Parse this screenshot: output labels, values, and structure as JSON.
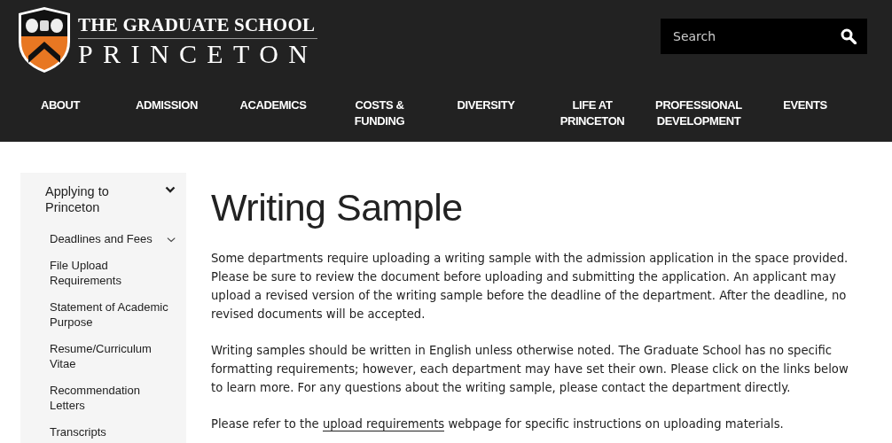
{
  "header": {
    "logo": {
      "line_1": "THE GRADUATE SCHOOL",
      "line_2": "PRINCETON"
    },
    "search": {
      "placeholder": "Search"
    }
  },
  "nav": [
    {
      "label": "ABOUT"
    },
    {
      "label": "ADMISSION"
    },
    {
      "label": "ACADEMICS"
    },
    {
      "label": "COSTS & FUNDING"
    },
    {
      "label": "DIVERSITY"
    },
    {
      "label": "LIFE AT PRINCETON"
    },
    {
      "label": "PROFESSIONAL DEVELOPMENT"
    },
    {
      "label": "EVENTS"
    }
  ],
  "sidebar": {
    "items": [
      {
        "label": "Applying to Princeton",
        "expanded": true,
        "children": [
          {
            "label": "Deadlines and Fees",
            "has_submenu": true
          },
          {
            "label": "File Upload Requirements",
            "has_submenu": false
          },
          {
            "label": "Statement of Academic Purpose",
            "has_submenu": false
          },
          {
            "label": "Resume/Curriculum Vitae",
            "has_submenu": false
          },
          {
            "label": "Recommendation Letters",
            "has_submenu": false
          },
          {
            "label": "Transcripts",
            "has_submenu": false
          }
        ]
      }
    ]
  },
  "main": {
    "title": "Writing Sample",
    "paragraphs": [
      {
        "text": "Some departments require uploading a writing sample with the admission application in the space provided. Please be sure to review the document before uploading and submitting the application. An applicant may upload a revised version of the writing sample before the deadline of the department. After the deadline, no revised documents will be accepted."
      },
      {
        "text": "Writing samples should be written in English unless otherwise noted. The Graduate School has no specific formatting requirements; however, each department may have set their own.  Please click on the links below to learn more. For any questions about the writing sample, please contact the department directly."
      },
      {
        "text": "Please refer to the ",
        "link": "upload requirements",
        "after": " webpage for specific instructions on uploading materials."
      }
    ]
  }
}
